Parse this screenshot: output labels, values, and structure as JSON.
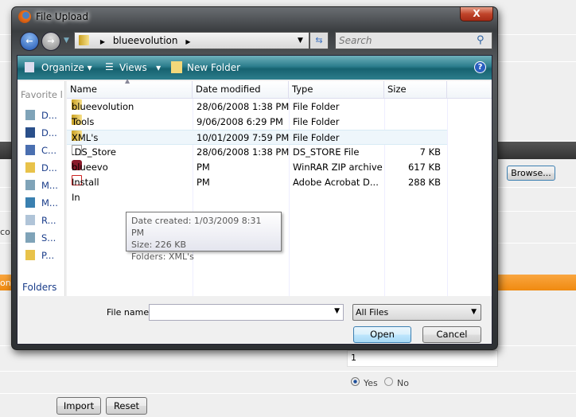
{
  "dialog": {
    "title": "File Upload",
    "close_label": "X",
    "breadcrumb": [
      "blueevolution"
    ],
    "search_placeholder": "Search",
    "toolbar": {
      "organize": "Organize",
      "views": "Views",
      "new_folder": "New Folder",
      "help": "?"
    },
    "nav": {
      "header": "Favorite l",
      "items": [
        "D...",
        "D...",
        "C...",
        "D...",
        "M...",
        "M...",
        "R...",
        "S...",
        "P..."
      ],
      "folders": "Folders"
    },
    "columns": [
      "Name",
      "Date modified",
      "Type",
      "Size"
    ],
    "files": [
      {
        "name": "blueevolution",
        "date": "28/06/2008 1:38 PM",
        "type": "File Folder",
        "size": "",
        "icon": "folder-icon"
      },
      {
        "name": "Tools",
        "date": "9/06/2008 6:29 PM",
        "type": "File Folder",
        "size": "",
        "icon": "folder-icon"
      },
      {
        "name": "XML's",
        "date": "10/01/2009 7:59 PM",
        "type": "File Folder",
        "size": "",
        "icon": "folder-icon",
        "selected": true
      },
      {
        "name": ".DS_Store",
        "date": "28/06/2008 1:38 PM",
        "type": "DS_STORE File",
        "size": "7 KB",
        "icon": "file-icon"
      },
      {
        "name": "blueevo",
        "date": "PM",
        "type": "WinRAR ZIP archive",
        "size": "617 KB",
        "icon": "winrar-icon"
      },
      {
        "name": "Install In",
        "date": "PM",
        "type": "Adobe Acrobat D...",
        "size": "288 KB",
        "icon": "pdf-icon"
      }
    ],
    "tooltip": [
      "Date created: 1/03/2009 8:31 PM",
      "Size: 226 KB",
      "Folders: XML's"
    ],
    "file_name_label": "File name:",
    "file_name_value": "",
    "filter": "All Files",
    "open": "Open",
    "cancel": "Cancel"
  },
  "page": {
    "browse": "Browse...",
    "fragment_left": "r co",
    "fragment_orange": "on",
    "number_value": "1",
    "radio_yes": "Yes",
    "radio_no": "No",
    "radio_selected": "Yes",
    "import": "Import",
    "reset": "Reset",
    "accent": "#f7941d"
  }
}
